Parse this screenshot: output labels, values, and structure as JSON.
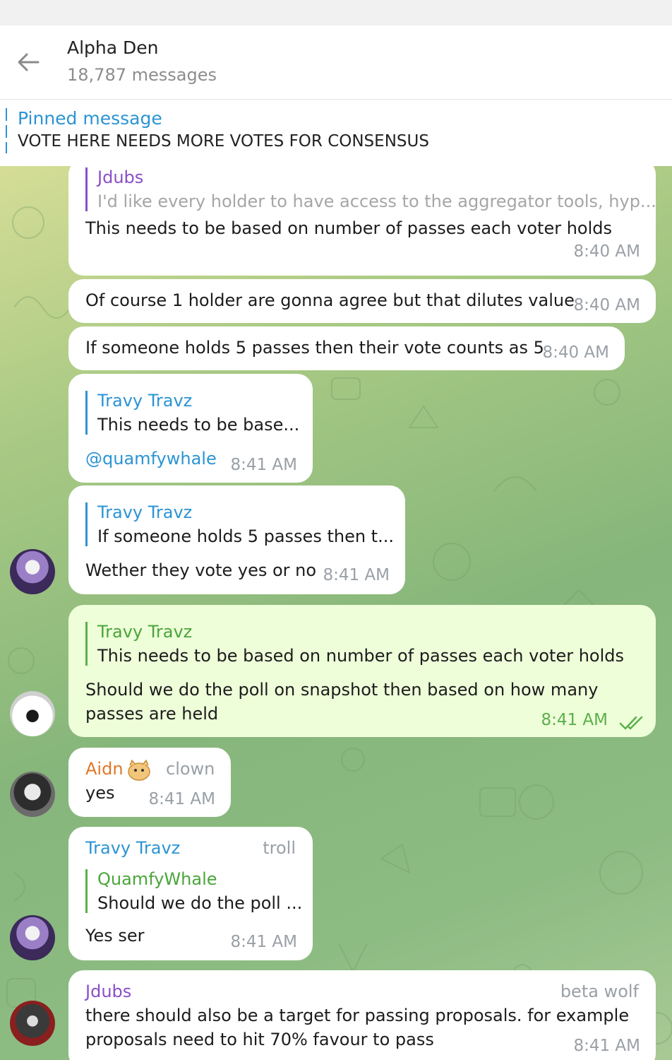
{
  "chat": {
    "title": "Alpha Den",
    "subtitle": "18,787 messages"
  },
  "pinned": {
    "label": "Pinned message",
    "text": "VOTE HERE NEEDS MORE VOTES FOR CONSENSUS"
  },
  "messages": [
    {
      "reply_name": "Jdubs",
      "reply_text": "I'd like every holder to have access to the aggregator tools, hyp...",
      "text": "This needs to be based on number of passes each voter holds",
      "time": "8:40 AM"
    },
    {
      "text": "Of course 1 holder are gonna agree but that dilutes value",
      "time": "8:40 AM"
    },
    {
      "text": "If someone holds 5 passes then their vote counts as 5",
      "time": "8:40 AM"
    },
    {
      "reply_name": "Travy Travz",
      "reply_text": "This needs to be base...",
      "text": "@quamfywhale",
      "time": "8:41 AM"
    },
    {
      "reply_name": "Travy Travz",
      "reply_text": "If someone holds 5 passes then t...",
      "text": "Wether they vote yes or no",
      "time": "8:41 AM"
    },
    {
      "reply_name": "Travy Travz",
      "reply_text": "This needs to be based on number of passes each voter holds",
      "text_line1": "Should we do the poll on snapshot then based on how many",
      "text_line2": "passes are held",
      "time": "8:41 AM"
    },
    {
      "sender": "Aidn",
      "tag": "clown",
      "text": "yes",
      "time": "8:41 AM"
    },
    {
      "sender": "Travy Travz",
      "tag": "troll",
      "reply_name": "QuamfyWhale",
      "reply_text": "Should we do the poll ...",
      "text": "Yes ser",
      "time": "8:41 AM"
    },
    {
      "sender": "Jdubs",
      "tag": "beta wolf",
      "text_line1": "there should also be a target for passing proposals. for example",
      "text_line2": "proposals need to hit 70% favour to pass",
      "time": "8:41 AM"
    }
  ],
  "colors": {
    "accent": "#2c94d4",
    "outgoing_bubble": "#eefed9",
    "outgoing_time": "#5bb04c",
    "sender_jdubs": "#8a4fc7",
    "sender_aidn": "#e0782a",
    "reply_quamfy": "#4aa53a"
  },
  "icons": {
    "back": "arrow-left-icon",
    "read": "double-check-icon"
  }
}
